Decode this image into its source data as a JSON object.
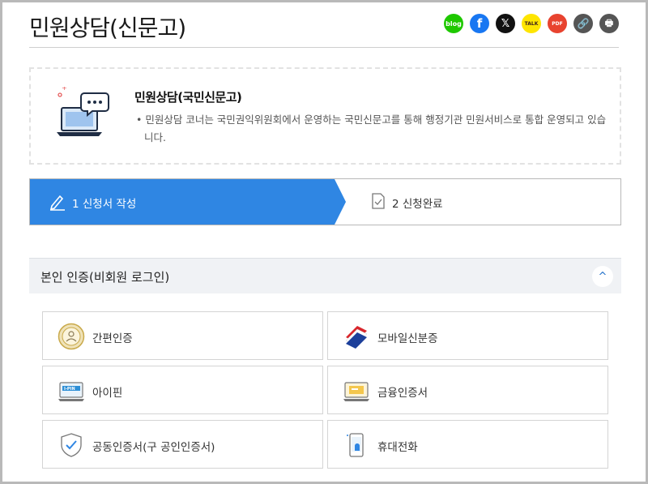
{
  "header": {
    "title": "민원상담(신문고)",
    "share_buttons": [
      {
        "name": "blog-share-button",
        "label": "blog"
      },
      {
        "name": "facebook-share-button",
        "label": "f"
      },
      {
        "name": "x-share-button",
        "label": "𝕏"
      },
      {
        "name": "kakaotalk-share-button",
        "label": "TALK"
      },
      {
        "name": "pdf-button",
        "label": "PDF"
      },
      {
        "name": "copy-link-button",
        "label": "🔗"
      },
      {
        "name": "print-button",
        "label": "🖶"
      }
    ]
  },
  "intro": {
    "title": "민원상담(국민신문고)",
    "description": "• 민원상담 코너는 국민권익위원회에서 운영하는 국민신문고를 통해 행정기관 민원서비스로 통합 운영되고 있습니다."
  },
  "steps": [
    {
      "label": "1 신청서 작성",
      "active": true,
      "icon": "pencil-icon"
    },
    {
      "label": "2 신청완료",
      "active": false,
      "icon": "document-check-icon"
    }
  ],
  "auth": {
    "title": "본인 인증(비회원 로그인)",
    "toggle": "^",
    "methods": [
      {
        "label": "간편인증",
        "icon": "simple-auth-icon"
      },
      {
        "label": "모바일신분증",
        "icon": "mobile-id-card-icon"
      },
      {
        "label": "아이핀",
        "icon": "ipin-icon"
      },
      {
        "label": "금융인증서",
        "icon": "financial-certificate-icon"
      },
      {
        "label": "공동인증서(구 공인인증서)",
        "icon": "joint-certificate-shield-icon"
      },
      {
        "label": "휴대전화",
        "icon": "mobile-phone-icon"
      }
    ]
  },
  "colors": {
    "accent": "#2f86e3",
    "blog": "#1ec800",
    "facebook": "#1877f2",
    "kakao": "#fee500",
    "pdf": "#e8432f"
  }
}
